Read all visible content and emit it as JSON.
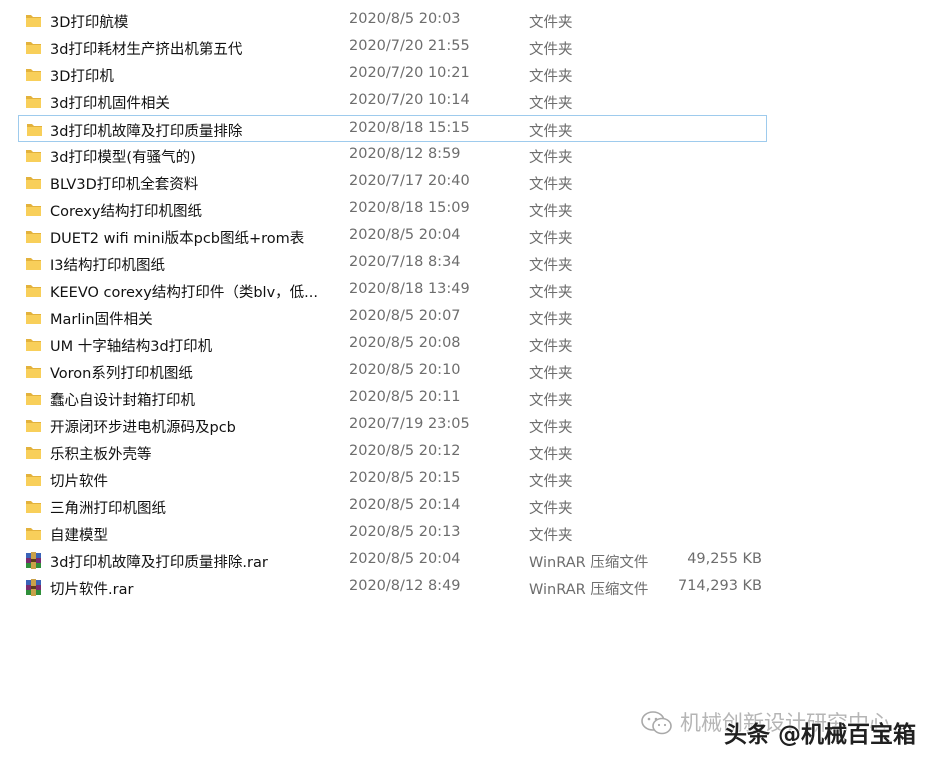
{
  "files": [
    {
      "name": "3D打印航模",
      "date": "2020/8/5 20:03",
      "type": "文件夹",
      "size": "",
      "icon": "folder-icon"
    },
    {
      "name": "3d打印耗材生产挤出机第五代",
      "date": "2020/7/20 21:55",
      "type": "文件夹",
      "size": "",
      "icon": "folder-icon"
    },
    {
      "name": "3D打印机",
      "date": "2020/7/20 10:21",
      "type": "文件夹",
      "size": "",
      "icon": "folder-icon"
    },
    {
      "name": "3d打印机固件相关",
      "date": "2020/7/20 10:14",
      "type": "文件夹",
      "size": "",
      "icon": "folder-icon"
    },
    {
      "name": "3d打印机故障及打印质量排除",
      "date": "2020/8/18 15:15",
      "type": "文件夹",
      "size": "",
      "icon": "folder-icon",
      "selected": true
    },
    {
      "name": "3d打印模型(有骚气的)",
      "date": "2020/8/12 8:59",
      "type": "文件夹",
      "size": "",
      "icon": "folder-icon"
    },
    {
      "name": "BLV3D打印机全套资料",
      "date": "2020/7/17 20:40",
      "type": "文件夹",
      "size": "",
      "icon": "folder-icon"
    },
    {
      "name": "Corexy结构打印机图纸",
      "date": "2020/8/18 15:09",
      "type": "文件夹",
      "size": "",
      "icon": "folder-icon"
    },
    {
      "name": "DUET2 wifi mini版本pcb图纸+rom表",
      "date": "2020/8/5 20:04",
      "type": "文件夹",
      "size": "",
      "icon": "folder-icon"
    },
    {
      "name": "I3结构打印机图纸",
      "date": "2020/7/18 8:34",
      "type": "文件夹",
      "size": "",
      "icon": "folder-icon"
    },
    {
      "name": "KEEVO corexy结构打印件（类blv，低...",
      "date": "2020/8/18 13:49",
      "type": "文件夹",
      "size": "",
      "icon": "folder-icon"
    },
    {
      "name": "Marlin固件相关",
      "date": "2020/8/5 20:07",
      "type": "文件夹",
      "size": "",
      "icon": "folder-icon"
    },
    {
      "name": "UM 十字轴结构3d打印机",
      "date": "2020/8/5 20:08",
      "type": "文件夹",
      "size": "",
      "icon": "folder-icon"
    },
    {
      "name": "Voron系列打印机图纸",
      "date": "2020/8/5 20:10",
      "type": "文件夹",
      "size": "",
      "icon": "folder-icon"
    },
    {
      "name": "蠢心自设计封箱打印机",
      "date": "2020/8/5 20:11",
      "type": "文件夹",
      "size": "",
      "icon": "folder-icon"
    },
    {
      "name": "开源闭环步进电机源码及pcb",
      "date": "2020/7/19 23:05",
      "type": "文件夹",
      "size": "",
      "icon": "folder-icon"
    },
    {
      "name": "乐积主板外壳等",
      "date": "2020/8/5 20:12",
      "type": "文件夹",
      "size": "",
      "icon": "folder-icon"
    },
    {
      "name": "切片软件",
      "date": "2020/8/5 20:15",
      "type": "文件夹",
      "size": "",
      "icon": "folder-icon"
    },
    {
      "name": "三角洲打印机图纸",
      "date": "2020/8/5 20:14",
      "type": "文件夹",
      "size": "",
      "icon": "folder-icon"
    },
    {
      "name": "自建模型",
      "date": "2020/8/5 20:13",
      "type": "文件夹",
      "size": "",
      "icon": "folder-icon"
    },
    {
      "name": "3d打印机故障及打印质量排除.rar",
      "date": "2020/8/5 20:04",
      "type": "WinRAR 压缩文件",
      "size": "49,255 KB",
      "icon": "winrar-icon"
    },
    {
      "name": "切片软件.rar",
      "date": "2020/8/12 8:49",
      "type": "WinRAR 压缩文件",
      "size": "714,293 KB",
      "icon": "winrar-icon"
    }
  ],
  "watermark": {
    "back_text": "机械创新设计研究中心",
    "front_text": "头条 @机械百宝箱",
    "icon": "wechat-icon"
  },
  "colors": {
    "folder": "#f8cf5a",
    "folder_dark": "#e3b23c",
    "selection_border": "#9ecbed",
    "secondary_text": "#6d6d6d"
  }
}
